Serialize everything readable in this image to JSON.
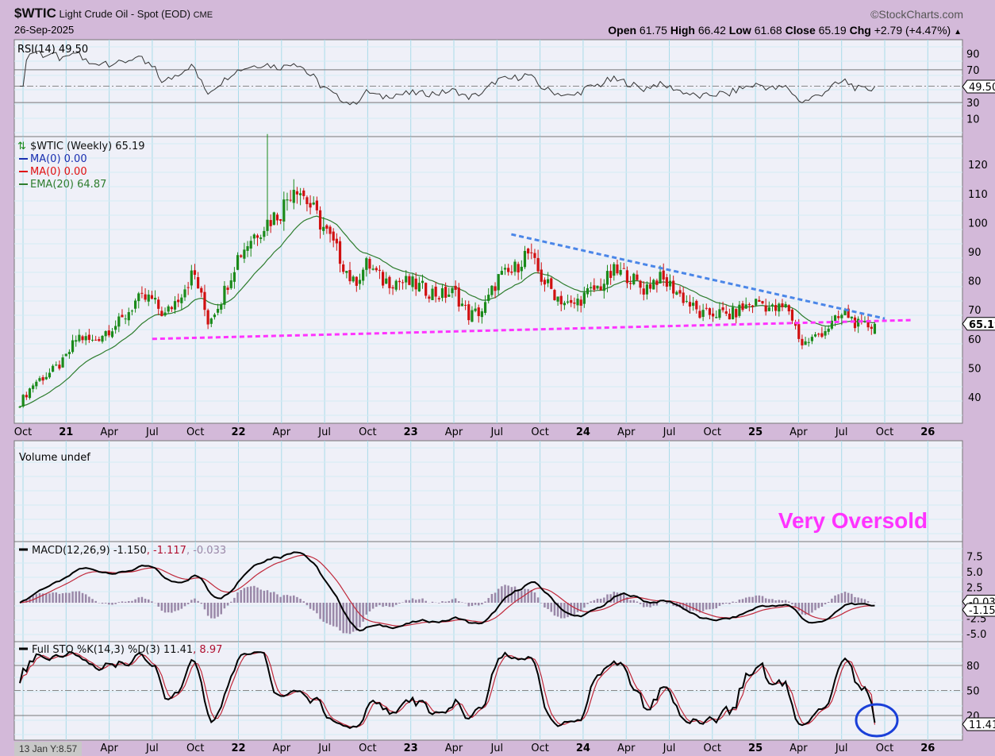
{
  "header": {
    "symbol": "$WTIC",
    "name": "Light Crude Oil - Spot (EOD)",
    "exchange": "CME",
    "date": "26-Sep-2025",
    "brand": "©StockCharts.com",
    "open_label": "Open",
    "open": "61.75",
    "high_label": "High",
    "high": "66.42",
    "low_label": "Low",
    "low": "61.68",
    "close_label": "Close",
    "close": "65.19",
    "chg_label": "Chg",
    "chg": "+2.79 (+4.47%)",
    "chg_arrow": "▲"
  },
  "hover_readout": "13 Jan Y:8.57",
  "colors": {
    "up": "#1a8a1a",
    "down": "#d01010",
    "ema": "#2e7d2e",
    "support": "#ff33ff",
    "resistance": "#4a86e8",
    "annotation": "#ff33ff",
    "circle": "#1a3fd8"
  },
  "chart_data": {
    "type": "line",
    "title": "$WTIC Light Crude Oil - Spot (EOD) CME",
    "x_start": "2020-10",
    "monthly_closes": [
      38,
      45,
      48,
      52,
      61,
      59,
      63,
      66,
      73,
      74,
      68,
      75,
      83,
      66,
      75,
      88,
      95,
      100,
      104,
      114,
      106,
      98,
      89,
      79,
      86,
      80,
      80,
      79,
      77,
      75,
      76,
      68,
      70,
      81,
      83,
      90,
      81,
      75,
      71,
      75,
      78,
      83,
      82,
      77,
      81,
      78,
      73,
      68,
      69,
      68,
      71,
      73,
      70,
      71,
      58,
      61,
      65,
      69,
      64,
      65.19
    ],
    "x_tick_labels": [
      "Oct",
      "21",
      "Apr",
      "Jul",
      "Oct",
      "22",
      "Apr",
      "Jul",
      "Oct",
      "23",
      "Apr",
      "Jul",
      "Oct",
      "24",
      "Apr",
      "Jul",
      "Oct",
      "25",
      "Apr",
      "Jul",
      "Oct",
      "26"
    ],
    "panels": {
      "rsi": {
        "legend": "RSI(14) 49.50",
        "value": "49.50",
        "ticks": [
          "90",
          "70",
          "30",
          "10"
        ],
        "ylim": [
          0,
          100
        ]
      },
      "price": {
        "legend": "$WTIC (Weekly) 65.19",
        "ma1": "MA(0) 0.00",
        "ma2": "MA(0) 0.00",
        "ema": "EMA(20) 64.87",
        "last": "65.19",
        "ticks": [
          "120",
          "110",
          "100",
          "90",
          "80",
          "70",
          "60",
          "50",
          "40"
        ],
        "ylim": [
          30,
          130
        ]
      },
      "volume": {
        "legend": "Volume undef"
      },
      "macd": {
        "legend": "MACD(12,26,9) -1.150",
        "signal": ", -1.117",
        "hist": ", -0.033",
        "last": "-1.150",
        "last_hist": "-0.033",
        "ticks": [
          "7.5",
          "5.0",
          "2.5",
          "-2.5",
          "-5.0"
        ]
      },
      "sto": {
        "legend": "Full STO %K(14,3) %D(3) 11.41",
        "d": ", 8.97",
        "last": "11.41",
        "ticks": [
          "80",
          "50",
          "20"
        ]
      }
    },
    "trendlines": [
      {
        "name": "support",
        "from": [
          "2021-07",
          60
        ],
        "to": [
          "2025-12",
          66.5
        ]
      },
      {
        "name": "resistance",
        "from": [
          "2023-08",
          96
        ],
        "to": [
          "2025-10",
          67
        ]
      }
    ],
    "annotation": "Very Oversold"
  }
}
